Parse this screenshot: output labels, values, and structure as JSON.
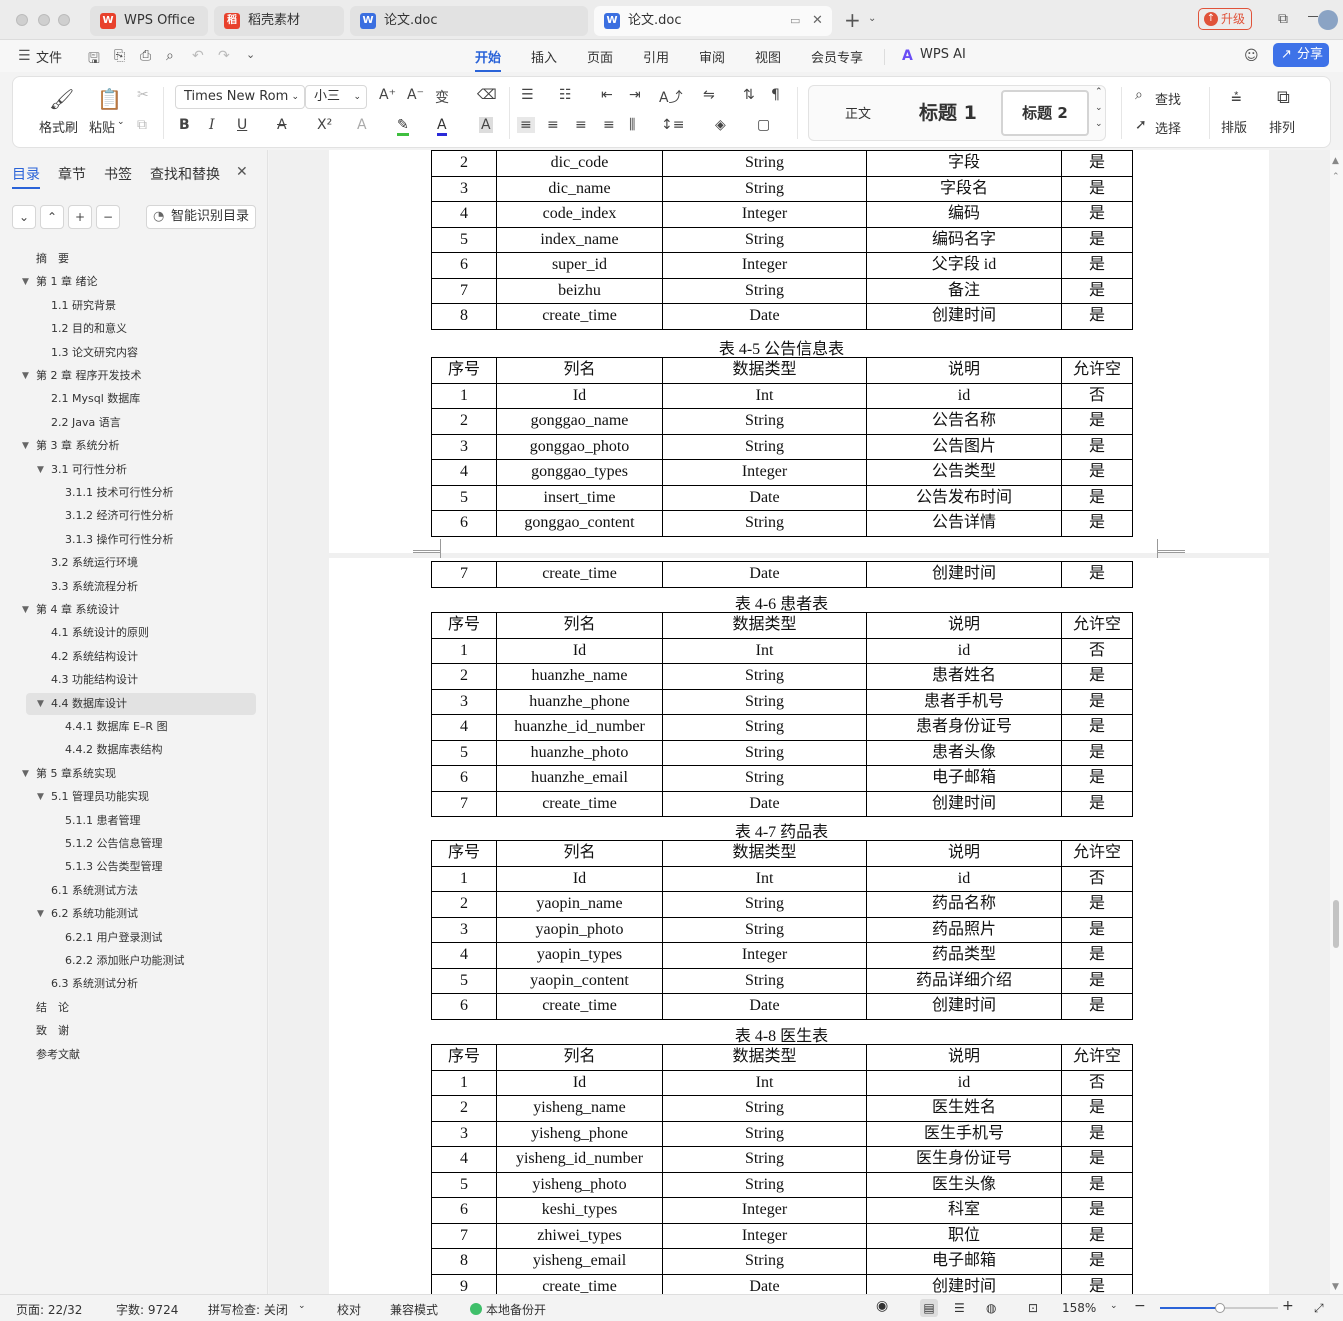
{
  "tabs": [
    {
      "label": "WPS Office",
      "icon": "wps-logo-icon"
    },
    {
      "label": "稻壳素材",
      "icon": "docer-icon"
    },
    {
      "label": "论文.doc",
      "icon": "word-doc-icon"
    },
    {
      "label": "论文.doc",
      "icon": "word-doc-icon"
    }
  ],
  "upgrade_label": "升级",
  "menu": {
    "file_label": "文件",
    "items": [
      "开始",
      "插入",
      "页面",
      "引用",
      "审阅",
      "视图",
      "会员专享"
    ],
    "ai_label": "WPS AI",
    "share_label": "分享"
  },
  "ribbon": {
    "format_painter": "格式刷",
    "paste": "粘贴",
    "font_name": "Times New Rom",
    "font_size": "小三",
    "style_normal": "正文",
    "style_h1": "标题 1",
    "style_h2": "标题 2",
    "find": "查找",
    "select": "选择",
    "layout": "排版",
    "arrange": "排列"
  },
  "sidebar": {
    "tabs": [
      "目录",
      "章节",
      "书签",
      "查找和替换"
    ],
    "smart_toc": "智能识别目录",
    "toc": [
      {
        "label": "摘　要",
        "level": 0,
        "caret": false
      },
      {
        "label": "第 1 章  绪论",
        "level": 0,
        "caret": true
      },
      {
        "label": "1.1  研究背景",
        "level": 1,
        "caret": false
      },
      {
        "label": "1.2 目的和意义",
        "level": 1,
        "caret": false
      },
      {
        "label": "1.3  论文研究内容",
        "level": 1,
        "caret": false
      },
      {
        "label": "第 2 章  程序开发技术",
        "level": 0,
        "caret": true
      },
      {
        "label": "2.1 Mysql 数据库",
        "level": 1,
        "caret": false
      },
      {
        "label": "2.2 Java 语言",
        "level": 1,
        "caret": false
      },
      {
        "label": "第 3 章  系统分析",
        "level": 0,
        "caret": true
      },
      {
        "label": "3.1 可行性分析",
        "level": 1,
        "caret": true
      },
      {
        "label": "3.1.1 技术可行性分析",
        "level": 2,
        "caret": false
      },
      {
        "label": "3.1.2  经济可行性分析",
        "level": 2,
        "caret": false
      },
      {
        "label": "3.1.3  操作可行性分析",
        "level": 2,
        "caret": false
      },
      {
        "label": "3.2 系统运行环境",
        "level": 1,
        "caret": false
      },
      {
        "label": "3.3 系统流程分析",
        "level": 1,
        "caret": false
      },
      {
        "label": "第 4 章  系统设计",
        "level": 0,
        "caret": true
      },
      {
        "label": "4.1  系统设计的原则",
        "level": 1,
        "caret": false
      },
      {
        "label": "4.2  系统结构设计",
        "level": 1,
        "caret": false
      },
      {
        "label": "4.3 功能结构设计",
        "level": 1,
        "caret": false
      },
      {
        "label": "4.4 数据库设计",
        "level": 1,
        "caret": true,
        "highlight": true
      },
      {
        "label": "4.4.1  数据库 E–R 图",
        "level": 2,
        "caret": false
      },
      {
        "label": "4.4.2  数据库表结构",
        "level": 2,
        "caret": false
      },
      {
        "label": "第 5 章系统实现",
        "level": 0,
        "caret": true
      },
      {
        "label": "5.1 管理员功能实现",
        "level": 1,
        "caret": true
      },
      {
        "label": "5.1.1  患者管理",
        "level": 2,
        "caret": false
      },
      {
        "label": "5.1.2  公告信息管理",
        "level": 2,
        "caret": false
      },
      {
        "label": "5.1.3 公告类型管理",
        "level": 2,
        "caret": false
      },
      {
        "label": "6.1 系统测试方法",
        "level": 1,
        "caret": false
      },
      {
        "label": "6.2  系统功能测试",
        "level": 1,
        "caret": true
      },
      {
        "label": "6.2.1  用户登录测试",
        "level": 2,
        "caret": false
      },
      {
        "label": "6.2.2  添加账户功能测试",
        "level": 2,
        "caret": false
      },
      {
        "label": "6.3  系统测试分析",
        "level": 1,
        "caret": false
      },
      {
        "label": "结　论",
        "level": 0,
        "caret": false
      },
      {
        "label": "致　谢",
        "level": 0,
        "caret": false
      },
      {
        "label": "参考文献",
        "level": 0,
        "caret": false
      }
    ]
  },
  "document": {
    "header_row": [
      "序号",
      "列名",
      "数据类型",
      "说明",
      "允许空"
    ],
    "cont_rows": [
      [
        "2",
        "dic_code",
        "String",
        "字段",
        "是"
      ],
      [
        "3",
        "dic_name",
        "String",
        "字段名",
        "是"
      ],
      [
        "4",
        "code_index",
        "Integer",
        "编码",
        "是"
      ],
      [
        "5",
        "index_name",
        "String",
        "编码名字",
        "是"
      ],
      [
        "6",
        "super_id",
        "Integer",
        "父字段 id",
        "是"
      ],
      [
        "7",
        "beizhu",
        "String",
        "备注",
        "是"
      ],
      [
        "8",
        "create_time",
        "Date",
        "创建时间",
        "是"
      ]
    ],
    "t45_caption": "表 4-5 公告信息表",
    "t45_rows": [
      [
        "1",
        "Id",
        "Int",
        "id",
        "否"
      ],
      [
        "2",
        "gonggao_name",
        "String",
        "公告名称",
        "是"
      ],
      [
        "3",
        "gonggao_photo",
        "String",
        "公告图片",
        "是"
      ],
      [
        "4",
        "gonggao_types",
        "Integer",
        "公告类型",
        "是"
      ],
      [
        "5",
        "insert_time",
        "Date",
        "公告发布时间",
        "是"
      ],
      [
        "6",
        "gonggao_content",
        "String",
        "公告详情",
        "是"
      ]
    ],
    "t45_cont_rows": [
      [
        "7",
        "create_time",
        "Date",
        "创建时间",
        "是"
      ]
    ],
    "t46_caption": "表 4-6 患者表",
    "t46_rows": [
      [
        "1",
        "Id",
        "Int",
        "id",
        "否"
      ],
      [
        "2",
        "huanzhe_name",
        "String",
        "患者姓名",
        "是"
      ],
      [
        "3",
        "huanzhe_phone",
        "String",
        "患者手机号",
        "是"
      ],
      [
        "4",
        "huanzhe_id_number",
        "String",
        "患者身份证号",
        "是"
      ],
      [
        "5",
        "huanzhe_photo",
        "String",
        "患者头像",
        "是"
      ],
      [
        "6",
        "huanzhe_email",
        "String",
        "电子邮箱",
        "是"
      ],
      [
        "7",
        "create_time",
        "Date",
        "创建时间",
        "是"
      ]
    ],
    "t47_caption": "表 4-7 药品表",
    "t47_rows": [
      [
        "1",
        "Id",
        "Int",
        "id",
        "否"
      ],
      [
        "2",
        "yaopin_name",
        "String",
        "药品名称",
        "是"
      ],
      [
        "3",
        "yaopin_photo",
        "String",
        "药品照片",
        "是"
      ],
      [
        "4",
        "yaopin_types",
        "Integer",
        "药品类型",
        "是"
      ],
      [
        "5",
        "yaopin_content",
        "String",
        "药品详细介绍",
        "是"
      ],
      [
        "6",
        "create_time",
        "Date",
        "创建时间",
        "是"
      ]
    ],
    "t48_caption": "表 4-8 医生表",
    "t48_rows": [
      [
        "1",
        "Id",
        "Int",
        "id",
        "否"
      ],
      [
        "2",
        "yisheng_name",
        "String",
        "医生姓名",
        "是"
      ],
      [
        "3",
        "yisheng_phone",
        "String",
        "医生手机号",
        "是"
      ],
      [
        "4",
        "yisheng_id_number",
        "String",
        "医生身份证号",
        "是"
      ],
      [
        "5",
        "yisheng_photo",
        "String",
        "医生头像",
        "是"
      ],
      [
        "6",
        "keshi_types",
        "Integer",
        "科室",
        "是"
      ],
      [
        "7",
        "zhiwei_types",
        "Integer",
        "职位",
        "是"
      ],
      [
        "8",
        "yisheng_email",
        "String",
        "电子邮箱",
        "是"
      ],
      [
        "9",
        "create_time",
        "Date",
        "创建时间",
        "是"
      ]
    ]
  },
  "status": {
    "page": "页面: 22/32",
    "words": "字数: 9724",
    "spell": "拼写检查: 关闭",
    "proof": "校对",
    "compat": "兼容模式",
    "backup": "本地备份开",
    "zoom": "158%"
  },
  "colors": {
    "accent": "#2a63d8",
    "upgrade": "#e0533a",
    "wps_red": "#e8412c",
    "word_blue": "#3b6fe0"
  }
}
